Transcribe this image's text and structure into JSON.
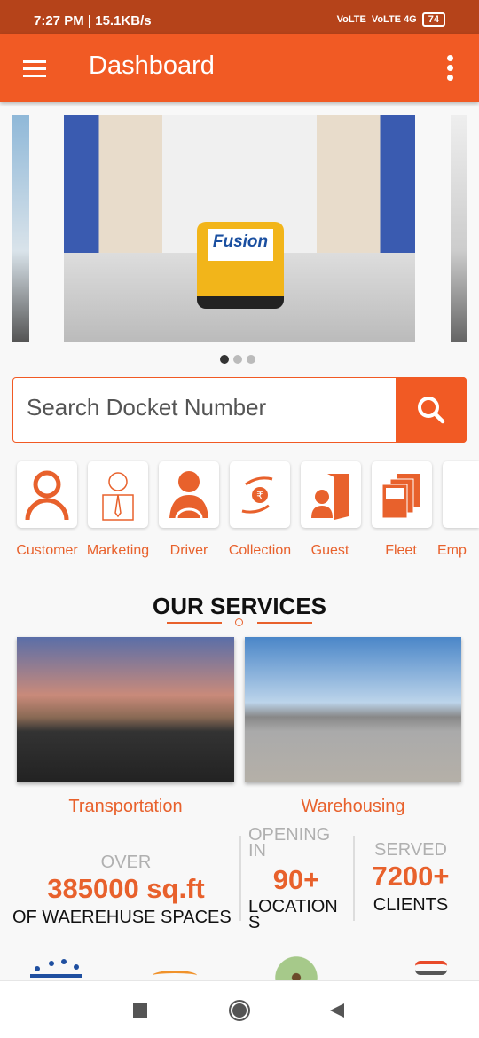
{
  "status_bar": {
    "time": "7:27 PM | 15.1KB/s",
    "network1": "VoLTE",
    "network2": "VoLTE 4G",
    "battery": "74"
  },
  "app_bar": {
    "title": "Dashboard",
    "menu_icon": "hamburger-icon",
    "more_icon": "more-vert-icon"
  },
  "carousel": {
    "logo_text": "Fusion",
    "slide_count": 3,
    "active_index": 0
  },
  "search": {
    "placeholder": "Search Docket Number",
    "value": "",
    "icon": "search-icon"
  },
  "categories": [
    {
      "label": "Customer",
      "icon": "person-outline-icon"
    },
    {
      "label": "Marketing",
      "icon": "businessman-icon"
    },
    {
      "label": "Driver",
      "icon": "driver-icon"
    },
    {
      "label": "Collection",
      "icon": "rupee-hands-icon"
    },
    {
      "label": "Guest",
      "icon": "guest-door-icon"
    },
    {
      "label": "Fleet",
      "icon": "trucks-icon"
    },
    {
      "label": "Emp",
      "icon": "employee-icon"
    }
  ],
  "services": {
    "title": "OUR SERVICES",
    "items": [
      {
        "label": "Transportation"
      },
      {
        "label": "Warehousing"
      }
    ]
  },
  "stats": [
    {
      "top": "OVER",
      "value": "385000 sq.ft",
      "bottom": "OF WAEREHUSE SPACES"
    },
    {
      "top": "OPENING IN",
      "value": "90+",
      "bottom": "LOCATIONS"
    },
    {
      "top": "SERVED",
      "value": "7200+",
      "bottom": "CLIENTS"
    }
  ],
  "colors": {
    "primary": "#f15a24",
    "status_bar": "#b5431a",
    "accent_text": "#e8612c"
  }
}
